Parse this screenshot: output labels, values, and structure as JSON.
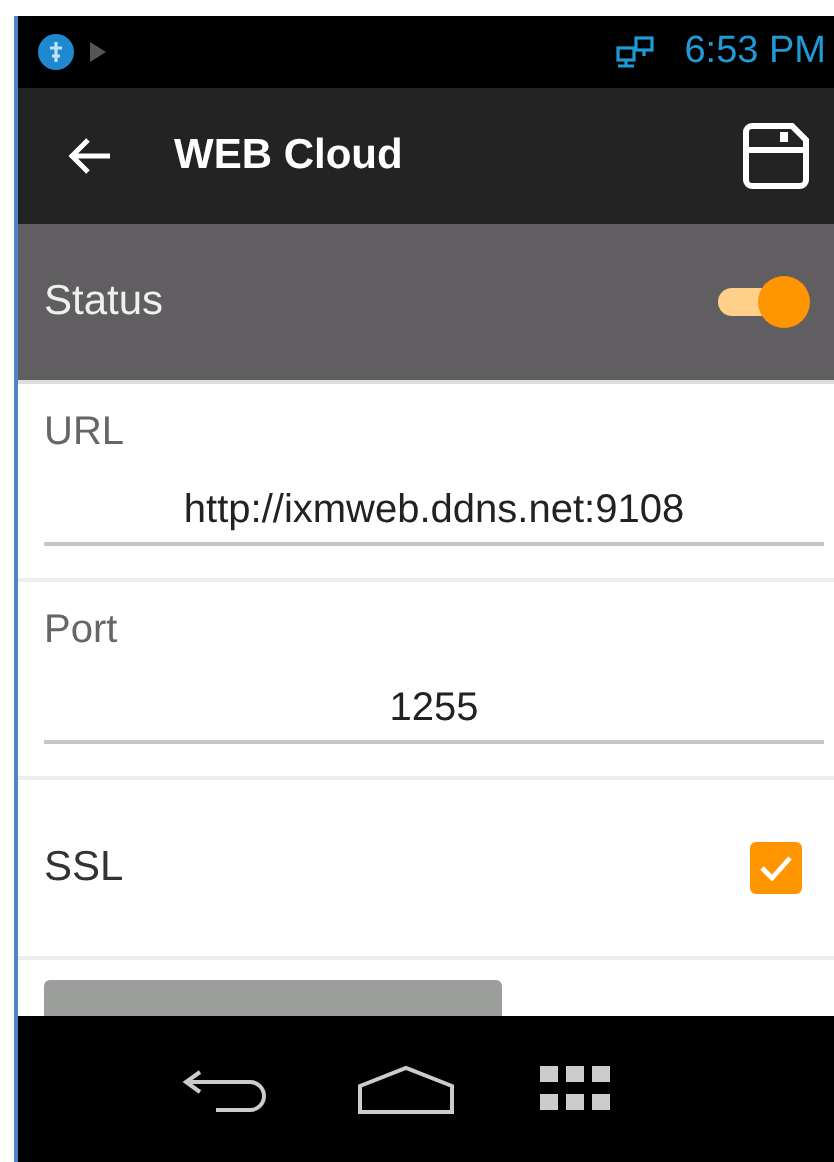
{
  "status_bar": {
    "time": "6:53 PM"
  },
  "toolbar": {
    "title": "WEB Cloud"
  },
  "status": {
    "label": "Status",
    "on": true
  },
  "fields": [
    {
      "label": "URL",
      "value": "http://ixmweb.ddns.net:9108"
    },
    {
      "label": "Port",
      "value": "1255"
    }
  ],
  "ssl": {
    "label": "SSL",
    "checked": true
  }
}
